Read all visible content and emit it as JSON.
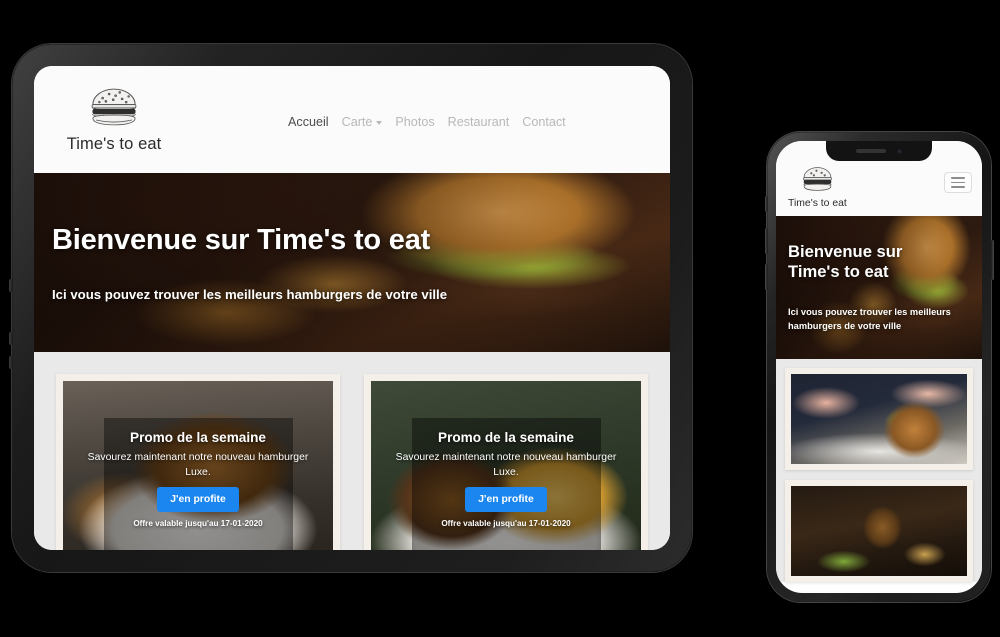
{
  "site": {
    "brand_name": "Time's to eat",
    "logo_icon": "burger-logo-icon",
    "accent_color": "#1b86f0",
    "nav_active_color": "#4d4d4d",
    "nav_inactive_color": "#b8b8b8",
    "section_bg_color": "#e9e9e9",
    "card_bg_color": "#f4efe9"
  },
  "nav": {
    "items": [
      {
        "label": "Accueil",
        "active": true,
        "has_dropdown": false
      },
      {
        "label": "Carte",
        "active": false,
        "has_dropdown": true
      },
      {
        "label": "Photos",
        "active": false,
        "has_dropdown": false
      },
      {
        "label": "Restaurant",
        "active": false,
        "has_dropdown": false
      },
      {
        "label": "Contact",
        "active": false,
        "has_dropdown": false
      }
    ]
  },
  "hero": {
    "title": "Bienvenue sur Time's to eat",
    "title_line1": "Bienvenue sur",
    "title_line2": "Time's to eat",
    "subtitle": "Ici vous pouvez trouver les meilleurs hamburgers de votre ville",
    "subtitle_line1": "Ici vous pouvez trouver les meilleurs",
    "subtitle_line2": "hamburgers de votre ville"
  },
  "promo_cards": [
    {
      "title": "Promo de la semaine",
      "description": "Savourez maintenant notre nouveau hamburger Luxe.",
      "button_label": "J'en profite",
      "note": "Offre valable jusqu'au 17-01-2020",
      "photo": "burger-fries-plate-photo"
    },
    {
      "title": "Promo de la semaine",
      "description": "Savourez maintenant notre nouveau hamburger Luxe.",
      "button_label": "J'en profite",
      "note": "Offre valable jusqu'au 17-01-2020",
      "photo": "double-burger-fries-photo"
    }
  ],
  "phone": {
    "menu_toggle_icon": "hamburger-menu-icon",
    "cards": [
      {
        "photo": "chef-slicing-burger-photo"
      },
      {
        "photo": "burger-with-drink-photo"
      }
    ]
  }
}
